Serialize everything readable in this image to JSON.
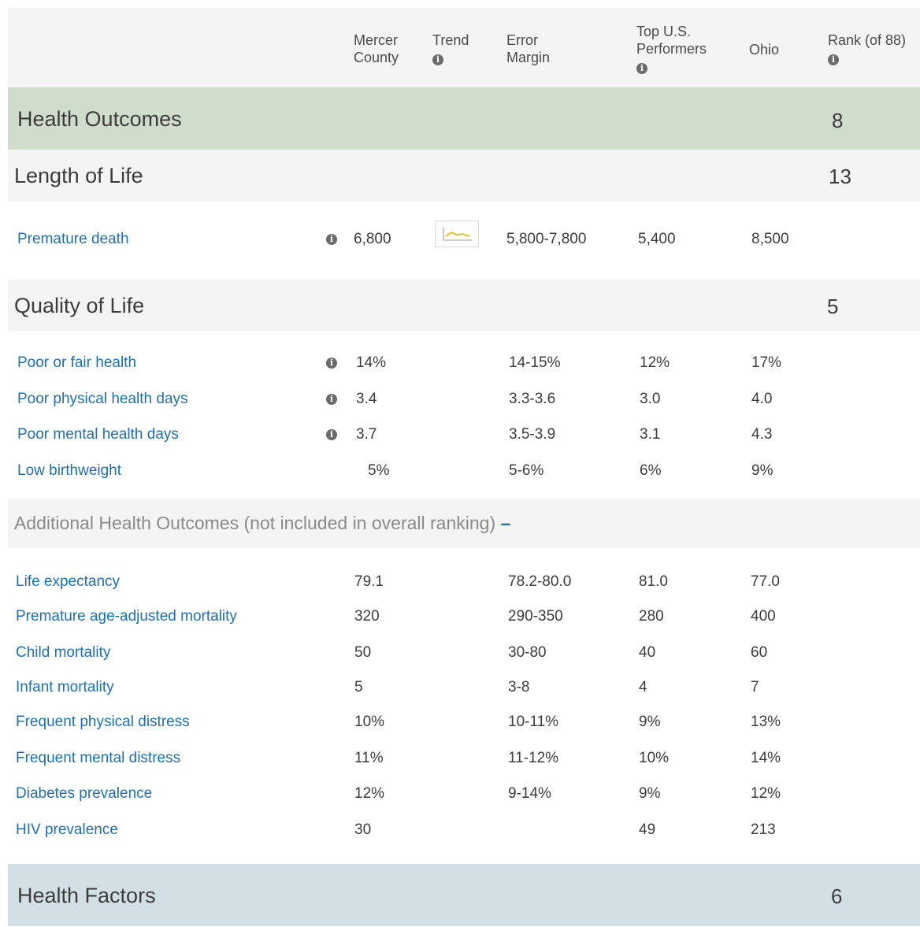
{
  "header": {
    "mercer": [
      "Mercer",
      "County"
    ],
    "trend": "Trend",
    "error": [
      "Error",
      "Margin"
    ],
    "top": [
      "Top U.S.",
      "Performers"
    ],
    "ohio": "Ohio",
    "rank": "Rank (of 88)",
    "info_glyph": "i"
  },
  "health_outcomes": {
    "title": "Health Outcomes",
    "rank": "8"
  },
  "length_of_life": {
    "title": "Length of Life",
    "rank": "13",
    "rows": [
      {
        "name": "Premature death",
        "county": "6,800",
        "error": "5,800-7,800",
        "top": "5,400",
        "state": "8,500"
      }
    ]
  },
  "quality_of_life": {
    "title": "Quality of Life",
    "rank": "5",
    "rows": [
      {
        "name": "Poor or fair health",
        "county": "14%",
        "error": "14-15%",
        "top": "12%",
        "state": "17%"
      },
      {
        "name": "Poor physical health days",
        "county": "3.4",
        "error": "3.3-3.6",
        "top": "3.0",
        "state": "4.0"
      },
      {
        "name": "Poor mental health days",
        "county": "3.7",
        "error": "3.5-3.9",
        "top": "3.1",
        "state": "4.3"
      },
      {
        "name": "Low birthweight",
        "county": "5%",
        "error": "5-6%",
        "top": "6%",
        "state": "9%"
      }
    ]
  },
  "additional": {
    "title": "Additional Health Outcomes (not included in overall ranking)",
    "toggle": "–",
    "rows": [
      {
        "name": "Life expectancy",
        "county": "79.1",
        "error": "78.2-80.0",
        "top": "81.0",
        "state": "77.0"
      },
      {
        "name": "Premature age-adjusted mortality",
        "county": "320",
        "error": "290-350",
        "top": "280",
        "state": "400"
      },
      {
        "name": "Child mortality",
        "county": "50",
        "error": "30-80",
        "top": "40",
        "state": "60"
      },
      {
        "name": "Infant mortality",
        "county": "5",
        "error": "3-8",
        "top": "4",
        "state": "7"
      },
      {
        "name": "Frequent physical distress",
        "county": "10%",
        "error": "10-11%",
        "top": "9%",
        "state": "13%"
      },
      {
        "name": "Frequent mental distress",
        "county": "11%",
        "error": "11-12%",
        "top": "10%",
        "state": "14%"
      },
      {
        "name": "Diabetes prevalence",
        "county": "12%",
        "error": "9-14%",
        "top": "9%",
        "state": "12%"
      },
      {
        "name": "HIV prevalence",
        "county": "30",
        "error": "",
        "top": "49",
        "state": "213"
      }
    ]
  },
  "health_factors": {
    "title": "Health Factors",
    "rank": "6"
  },
  "colors": {
    "header_bg": "#f4f4f4",
    "outcomes_bg": "#d0dccc",
    "section_bg": "#f4f4f4",
    "factors_bg": "#d2e0e6",
    "link": "#1f6fb2",
    "trend_line": "#f0b400"
  }
}
